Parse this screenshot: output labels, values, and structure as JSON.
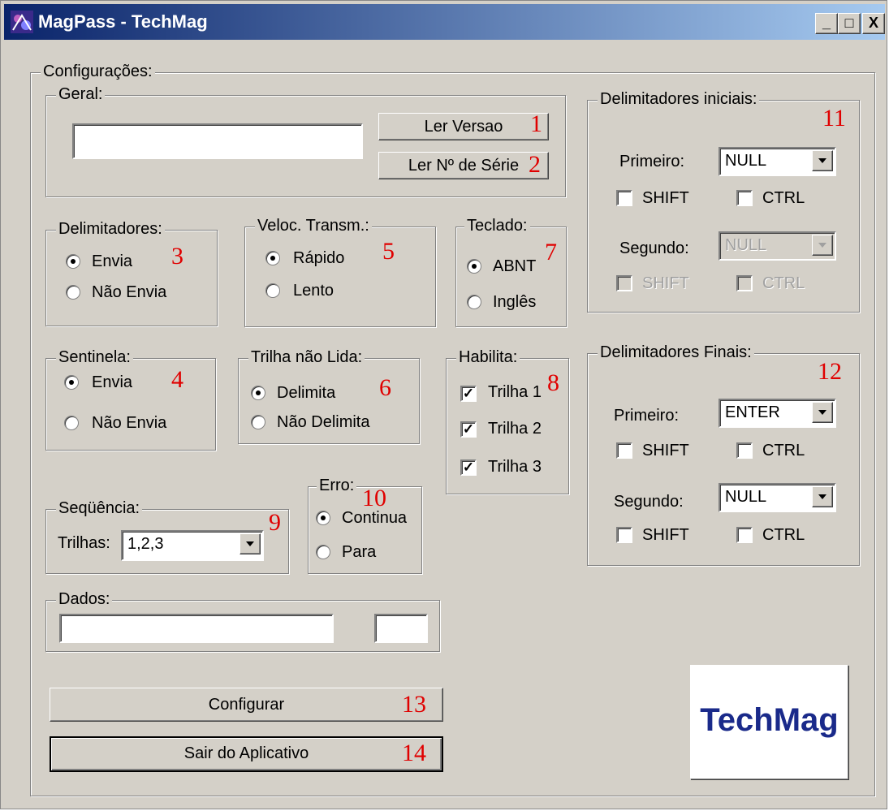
{
  "window": {
    "title": "MagPass - TechMag",
    "minimize": "_",
    "maximize": "□",
    "close": "X"
  },
  "configuracoes": {
    "label": "Configurações:"
  },
  "geral": {
    "label": "Geral:",
    "value": "",
    "ler_versao": "Ler Versao",
    "ler_serie": "Ler Nº de Série"
  },
  "delimitadores": {
    "label": "Delimitadores:",
    "options": [
      "Envia",
      "Não Envia"
    ],
    "selected": "Envia"
  },
  "veloc": {
    "label": "Veloc. Transm.:",
    "options": [
      "Rápido",
      "Lento"
    ],
    "selected": "Rápido"
  },
  "teclado": {
    "label": "Teclado:",
    "options": [
      "ABNT",
      "Inglês"
    ],
    "selected": "ABNT"
  },
  "sentinela": {
    "label": "Sentinela:",
    "options": [
      "Envia",
      "Não Envia"
    ],
    "selected": "Envia"
  },
  "trilha_nao_lida": {
    "label": "Trilha não Lida:",
    "options": [
      "Delimita",
      "Não Delimita"
    ],
    "selected": "Delimita"
  },
  "habilita": {
    "label": "Habilita:",
    "items": [
      "Trilha 1",
      "Trilha 2",
      "Trilha 3"
    ],
    "checked": [
      true,
      true,
      true
    ]
  },
  "sequencia": {
    "label": "Seqüência:",
    "trilhas_label": "Trilhas:",
    "value": "1,2,3"
  },
  "erro": {
    "label": "Erro:",
    "options": [
      "Continua",
      "Para"
    ],
    "selected": "Continua"
  },
  "dados": {
    "label": "Dados:",
    "value": "",
    "count": ""
  },
  "delim_iniciais": {
    "label": "Delimitadores iniciais:",
    "primeiro_label": "Primeiro:",
    "primeiro_value": "NULL",
    "segundo_label": "Segundo:",
    "segundo_value": "NULL",
    "shift": "SHIFT",
    "ctrl": "CTRL",
    "segundo_enabled": false
  },
  "delim_finais": {
    "label": "Delimitadores Finais:",
    "primeiro_label": "Primeiro:",
    "primeiro_value": "ENTER",
    "segundo_label": "Segundo:",
    "segundo_value": "NULL",
    "shift": "SHIFT",
    "ctrl": "CTRL"
  },
  "buttons": {
    "configurar": "Configurar",
    "sair": "Sair do Aplicativo"
  },
  "logo": {
    "text": "TechMag"
  },
  "annotations": [
    "1",
    "2",
    "3",
    "4",
    "5",
    "6",
    "7",
    "8",
    "9",
    "10",
    "11",
    "12",
    "13",
    "14"
  ],
  "colors": {
    "title_start": "#0a246a",
    "title_end": "#a6caf0",
    "face": "#d4d0c8",
    "annotation": "#e00000",
    "logo_text": "#1a2a8a"
  }
}
